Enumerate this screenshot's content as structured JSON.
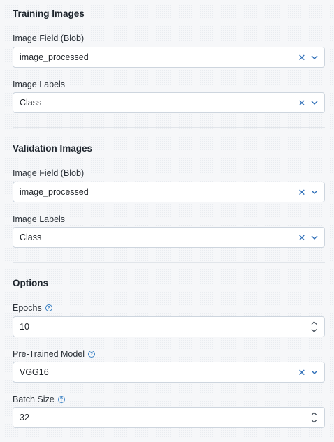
{
  "training": {
    "title": "Training Images",
    "image_field_label": "Image Field (Blob)",
    "image_field_value": "image_processed",
    "image_labels_label": "Image Labels",
    "image_labels_value": "Class"
  },
  "validation": {
    "title": "Validation Images",
    "image_field_label": "Image Field (Blob)",
    "image_field_value": "image_processed",
    "image_labels_label": "Image Labels",
    "image_labels_value": "Class"
  },
  "options": {
    "title": "Options",
    "epochs_label": "Epochs",
    "epochs_value": "10",
    "model_label": "Pre-Trained Model",
    "model_value": "VGG16",
    "batch_label": "Batch Size",
    "batch_value": "32"
  },
  "icons": {
    "clear": "close-icon",
    "dropdown": "chevron-down-icon",
    "help": "help-circle-icon",
    "step_up": "chevron-up-icon",
    "step_down": "chevron-down-icon"
  },
  "colors": {
    "accent": "#2f6fb8",
    "border": "#cdd5de"
  }
}
